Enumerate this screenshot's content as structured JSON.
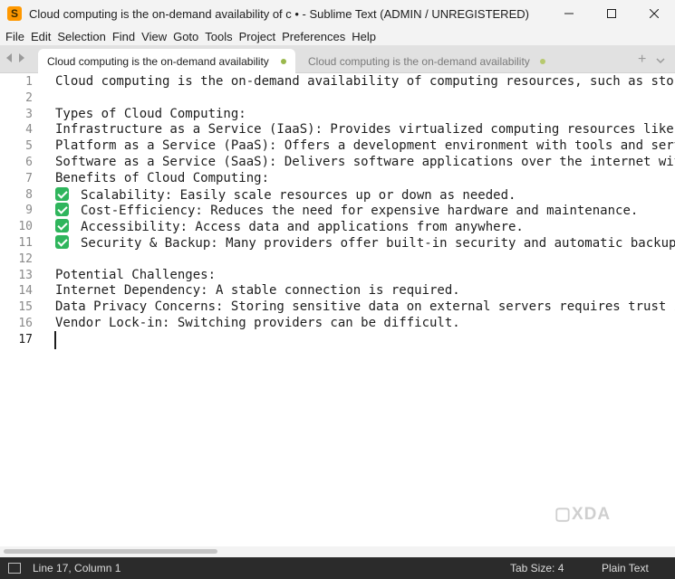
{
  "window": {
    "title": "Cloud computing is the on-demand availability of c • - Sublime Text (ADMIN / UNREGISTERED)"
  },
  "menu": [
    "File",
    "Edit",
    "Selection",
    "Find",
    "View",
    "Goto",
    "Tools",
    "Project",
    "Preferences",
    "Help"
  ],
  "tabs": [
    {
      "label": "Cloud computing is the on-demand availability of c",
      "active": true
    },
    {
      "label": "Cloud computing is the on-demand availability of c",
      "active": false
    }
  ],
  "editor": {
    "lines": [
      {
        "num": "1",
        "text": "Cloud computing is the on-demand availability of computing resources, such as stora"
      },
      {
        "num": "2",
        "text": ""
      },
      {
        "num": "3",
        "text": "Types of Cloud Computing:"
      },
      {
        "num": "4",
        "text": "Infrastructure as a Service (IaaS): Provides virtualized computing resources like s"
      },
      {
        "num": "5",
        "text": "Platform as a Service (PaaS): Offers a development environment with tools and servi"
      },
      {
        "num": "6",
        "text": "Software as a Service (SaaS): Delivers software applications over the internet with"
      },
      {
        "num": "7",
        "text": "Benefits of Cloud Computing:"
      },
      {
        "num": "8",
        "text": "Scalability: Easily scale resources up or down as needed.",
        "check": true
      },
      {
        "num": "9",
        "text": "Cost-Efficiency: Reduces the need for expensive hardware and maintenance.",
        "check": true
      },
      {
        "num": "10",
        "text": "Accessibility: Access data and applications from anywhere.",
        "check": true
      },
      {
        "num": "11",
        "text": "Security & Backup: Many providers offer built-in security and automatic backups",
        "check": true
      },
      {
        "num": "12",
        "text": ""
      },
      {
        "num": "13",
        "text": "Potential Challenges:"
      },
      {
        "num": "14",
        "text": "Internet Dependency: A stable connection is required."
      },
      {
        "num": "15",
        "text": "Data Privacy Concerns: Storing sensitive data on external servers requires trust in"
      },
      {
        "num": "16",
        "text": "Vendor Lock-in: Switching providers can be difficult."
      },
      {
        "num": "17",
        "text": ""
      }
    ],
    "current_line": "17",
    "watermark": "XDA"
  },
  "status": {
    "position": "Line 17, Column 1",
    "tab_size": "Tab Size: 4",
    "syntax": "Plain Text"
  },
  "colors": {
    "check_green": "#2fb55c",
    "status_bar": "#2b2b2b",
    "dirty_dot": "#9ab84d"
  }
}
